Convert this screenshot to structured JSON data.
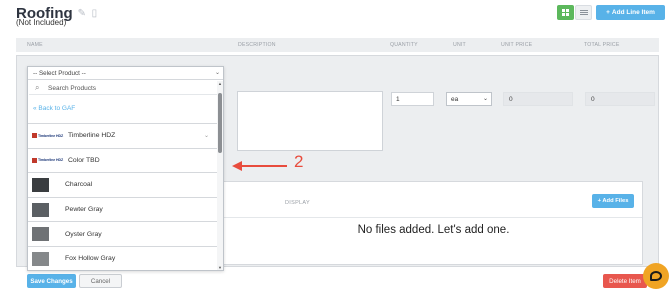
{
  "header": {
    "title": "Roofing",
    "subtitle": "(Not Included)",
    "add_line_item": "Add Line Item",
    "plus": "+"
  },
  "icons": {
    "edit": "pencil-icon",
    "delete": "trash-icon",
    "grid_view": "grid-view-icon",
    "list_view": "list-view-icon",
    "search": "search-icon",
    "chat": "chat-icon"
  },
  "colors": {
    "accent_blue": "#58b2e8",
    "green": "#5cb85c",
    "danger": "#e8574e",
    "annotation": "#e84c3d",
    "chat": "#f0a424"
  },
  "table": {
    "columns": [
      "NAME",
      "DESCRIPTION",
      "QUANTITY",
      "UNIT",
      "UNIT PRICE",
      "TOTAL PRICE"
    ]
  },
  "line_item": {
    "quantity": "1",
    "unit": "ea",
    "unit_price": "0",
    "total_price": "0"
  },
  "dropdown": {
    "selected": "-- Select Product --",
    "search_placeholder": "Search Products",
    "back_link": "« Back to GAF",
    "brand_logo_text": "Timberline HDZ",
    "items": [
      {
        "label": "Timberline HDZ",
        "kind": "brand"
      },
      {
        "label": "Color TBD",
        "kind": "brand"
      },
      {
        "label": "Charcoal",
        "kind": "swatch",
        "swatch": "#3a3d40"
      },
      {
        "label": "Pewter Gray",
        "kind": "swatch",
        "swatch": "#5b5f63"
      },
      {
        "label": "Oyster Gray",
        "kind": "swatch",
        "swatch": "#6f7275"
      },
      {
        "label": "Fox Hollow Gray",
        "kind": "swatch",
        "swatch": "#85888a"
      }
    ]
  },
  "files": {
    "display_label": "DISPLAY",
    "add_files": "+ Add Files",
    "empty_message": "No files added. Let's add one."
  },
  "annotation": {
    "number": "2"
  },
  "footer": {
    "save": "Save Changes",
    "cancel": "Cancel",
    "delete": "Delete Item"
  }
}
